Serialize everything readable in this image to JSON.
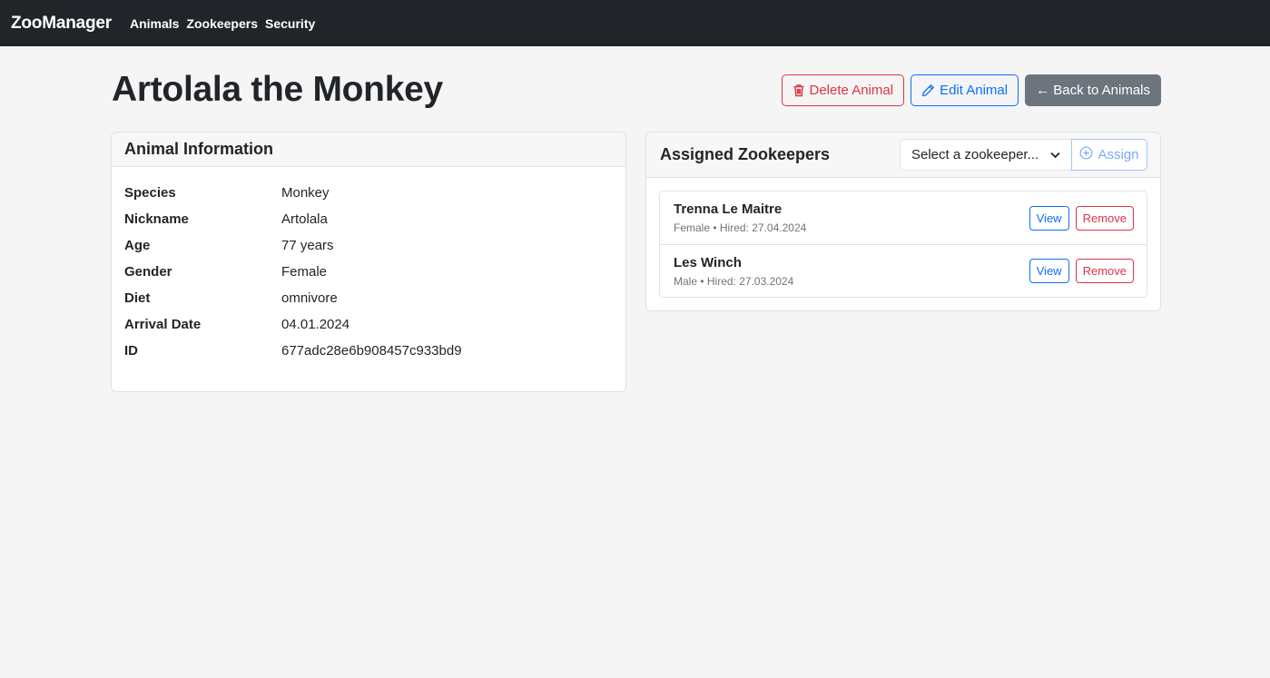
{
  "navbar": {
    "brand": "ZooManager",
    "links": [
      "Animals",
      "Zookeepers",
      "Security"
    ]
  },
  "page": {
    "title": "Artolala the Monkey",
    "delete_label": "Delete Animal",
    "edit_label": "Edit Animal",
    "back_label": "← Back to Animals"
  },
  "info": {
    "header": "Animal Information",
    "rows": [
      {
        "label": "Species",
        "value": "Monkey"
      },
      {
        "label": "Nickname",
        "value": "Artolala"
      },
      {
        "label": "Age",
        "value": "77 years"
      },
      {
        "label": "Gender",
        "value": "Female"
      },
      {
        "label": "Diet",
        "value": "omnivore"
      },
      {
        "label": "Arrival Date",
        "value": "04.01.2024"
      },
      {
        "label": "ID",
        "value": "677adc28e6b908457c933bd9"
      }
    ]
  },
  "keepers": {
    "header": "Assigned Zookeepers",
    "select_placeholder": "Select a zookeeper...",
    "assign_label": "Assign",
    "view_label": "View",
    "remove_label": "Remove",
    "items": [
      {
        "name": "Trenna Le Maitre",
        "meta": "Female • Hired: 27.04.2024"
      },
      {
        "name": "Les Winch",
        "meta": "Male • Hired: 27.03.2024"
      }
    ]
  },
  "colors": {
    "navbar": "#212529",
    "danger": "#dc3545",
    "primary": "#0d6efd",
    "secondary": "#6c757d"
  }
}
